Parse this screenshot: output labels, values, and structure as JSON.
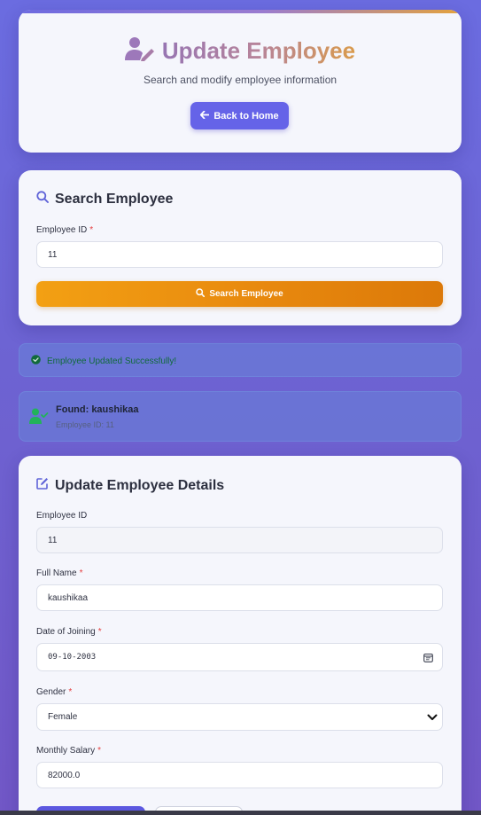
{
  "header": {
    "title": "Update Employee",
    "subtitle": "Search and modify employee information",
    "back_button": "Back to Home",
    "icon": "user-edit-icon"
  },
  "search": {
    "title": "Search Employee",
    "icon": "search-icon",
    "employee_id_label": "Employee ID",
    "employee_id_value": "11",
    "button_label": "Search Employee"
  },
  "alerts": {
    "success_message": "Employee Updated Successfully!",
    "found_title": "Found: kaushikaa",
    "found_subtitle": "Employee ID: 11"
  },
  "update": {
    "title": "Update Employee Details",
    "icon": "edit-icon",
    "fields": {
      "employee_id": {
        "label": "Employee ID",
        "value": "11"
      },
      "full_name": {
        "label": "Full Name",
        "value": "kaushikaa"
      },
      "date_of_joining": {
        "label": "Date of Joining",
        "value": "09-10-2003"
      },
      "gender": {
        "label": "Gender",
        "value": "Female"
      },
      "monthly_salary": {
        "label": "Monthly Salary",
        "value": "82000.0"
      }
    }
  },
  "colors": {
    "accent": "#6563e8",
    "search_button": "#f3a013",
    "success_text": "#116a3b",
    "required": "#e53e3e"
  }
}
